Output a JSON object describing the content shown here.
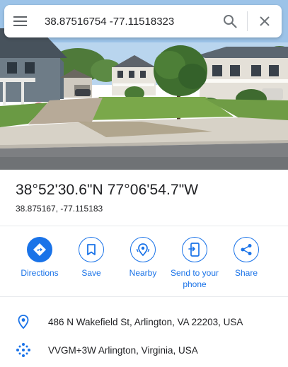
{
  "search": {
    "query": "38.87516754 -77.11518323"
  },
  "place": {
    "title": "38°52'30.6\"N 77°06'54.7\"W",
    "decimal": "38.875167, -77.115183"
  },
  "actions": [
    {
      "label": "Directions",
      "icon": "directions-icon"
    },
    {
      "label": "Save",
      "icon": "bookmark-icon"
    },
    {
      "label": "Nearby",
      "icon": "nearby-icon"
    },
    {
      "label": "Send to your phone",
      "icon": "send-to-phone-icon"
    },
    {
      "label": "Share",
      "icon": "share-icon"
    }
  ],
  "details": {
    "address": "486 N Wakefield St, Arlington, VA 22203, USA",
    "plus_code": "VVGM+3W Arlington, Virginia, USA"
  },
  "colors": {
    "accent": "#1a73e8",
    "text": "#202124",
    "icon_gray": "#5f6368"
  }
}
